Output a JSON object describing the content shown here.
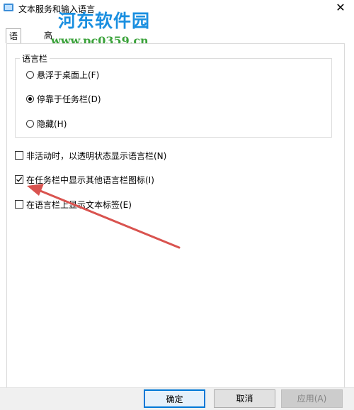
{
  "window": {
    "title": "文本服务和输入语言",
    "close_glyph": "✕"
  },
  "watermark": {
    "logo": "河东软件园",
    "url": "www.pc0359.cn"
  },
  "tabs": [
    {
      "label": "语言栏",
      "active": true
    },
    {
      "label": "高级键设置",
      "active": false
    }
  ],
  "language_bar": {
    "legend": "语言栏",
    "options": [
      {
        "label": "悬浮于桌面上(F)",
        "selected": false
      },
      {
        "label": "停靠于任务栏(D)",
        "selected": true
      },
      {
        "label": "隐藏(H)",
        "selected": false
      }
    ]
  },
  "checkboxes": [
    {
      "label": "非活动时，以透明状态显示语言栏(N)",
      "checked": false
    },
    {
      "label": "在任务栏中显示其他语言栏图标(I)",
      "checked": true
    },
    {
      "label": "在语言栏上显示文本标签(E)",
      "checked": false
    }
  ],
  "buttons": {
    "ok": "确定",
    "cancel": "取消",
    "apply": "应用(A)"
  },
  "colors": {
    "accent": "#0078d7",
    "annotation_arrow": "#d9534f",
    "watermark_blue": "#1a8fe0",
    "watermark_green": "#3aa23a"
  }
}
